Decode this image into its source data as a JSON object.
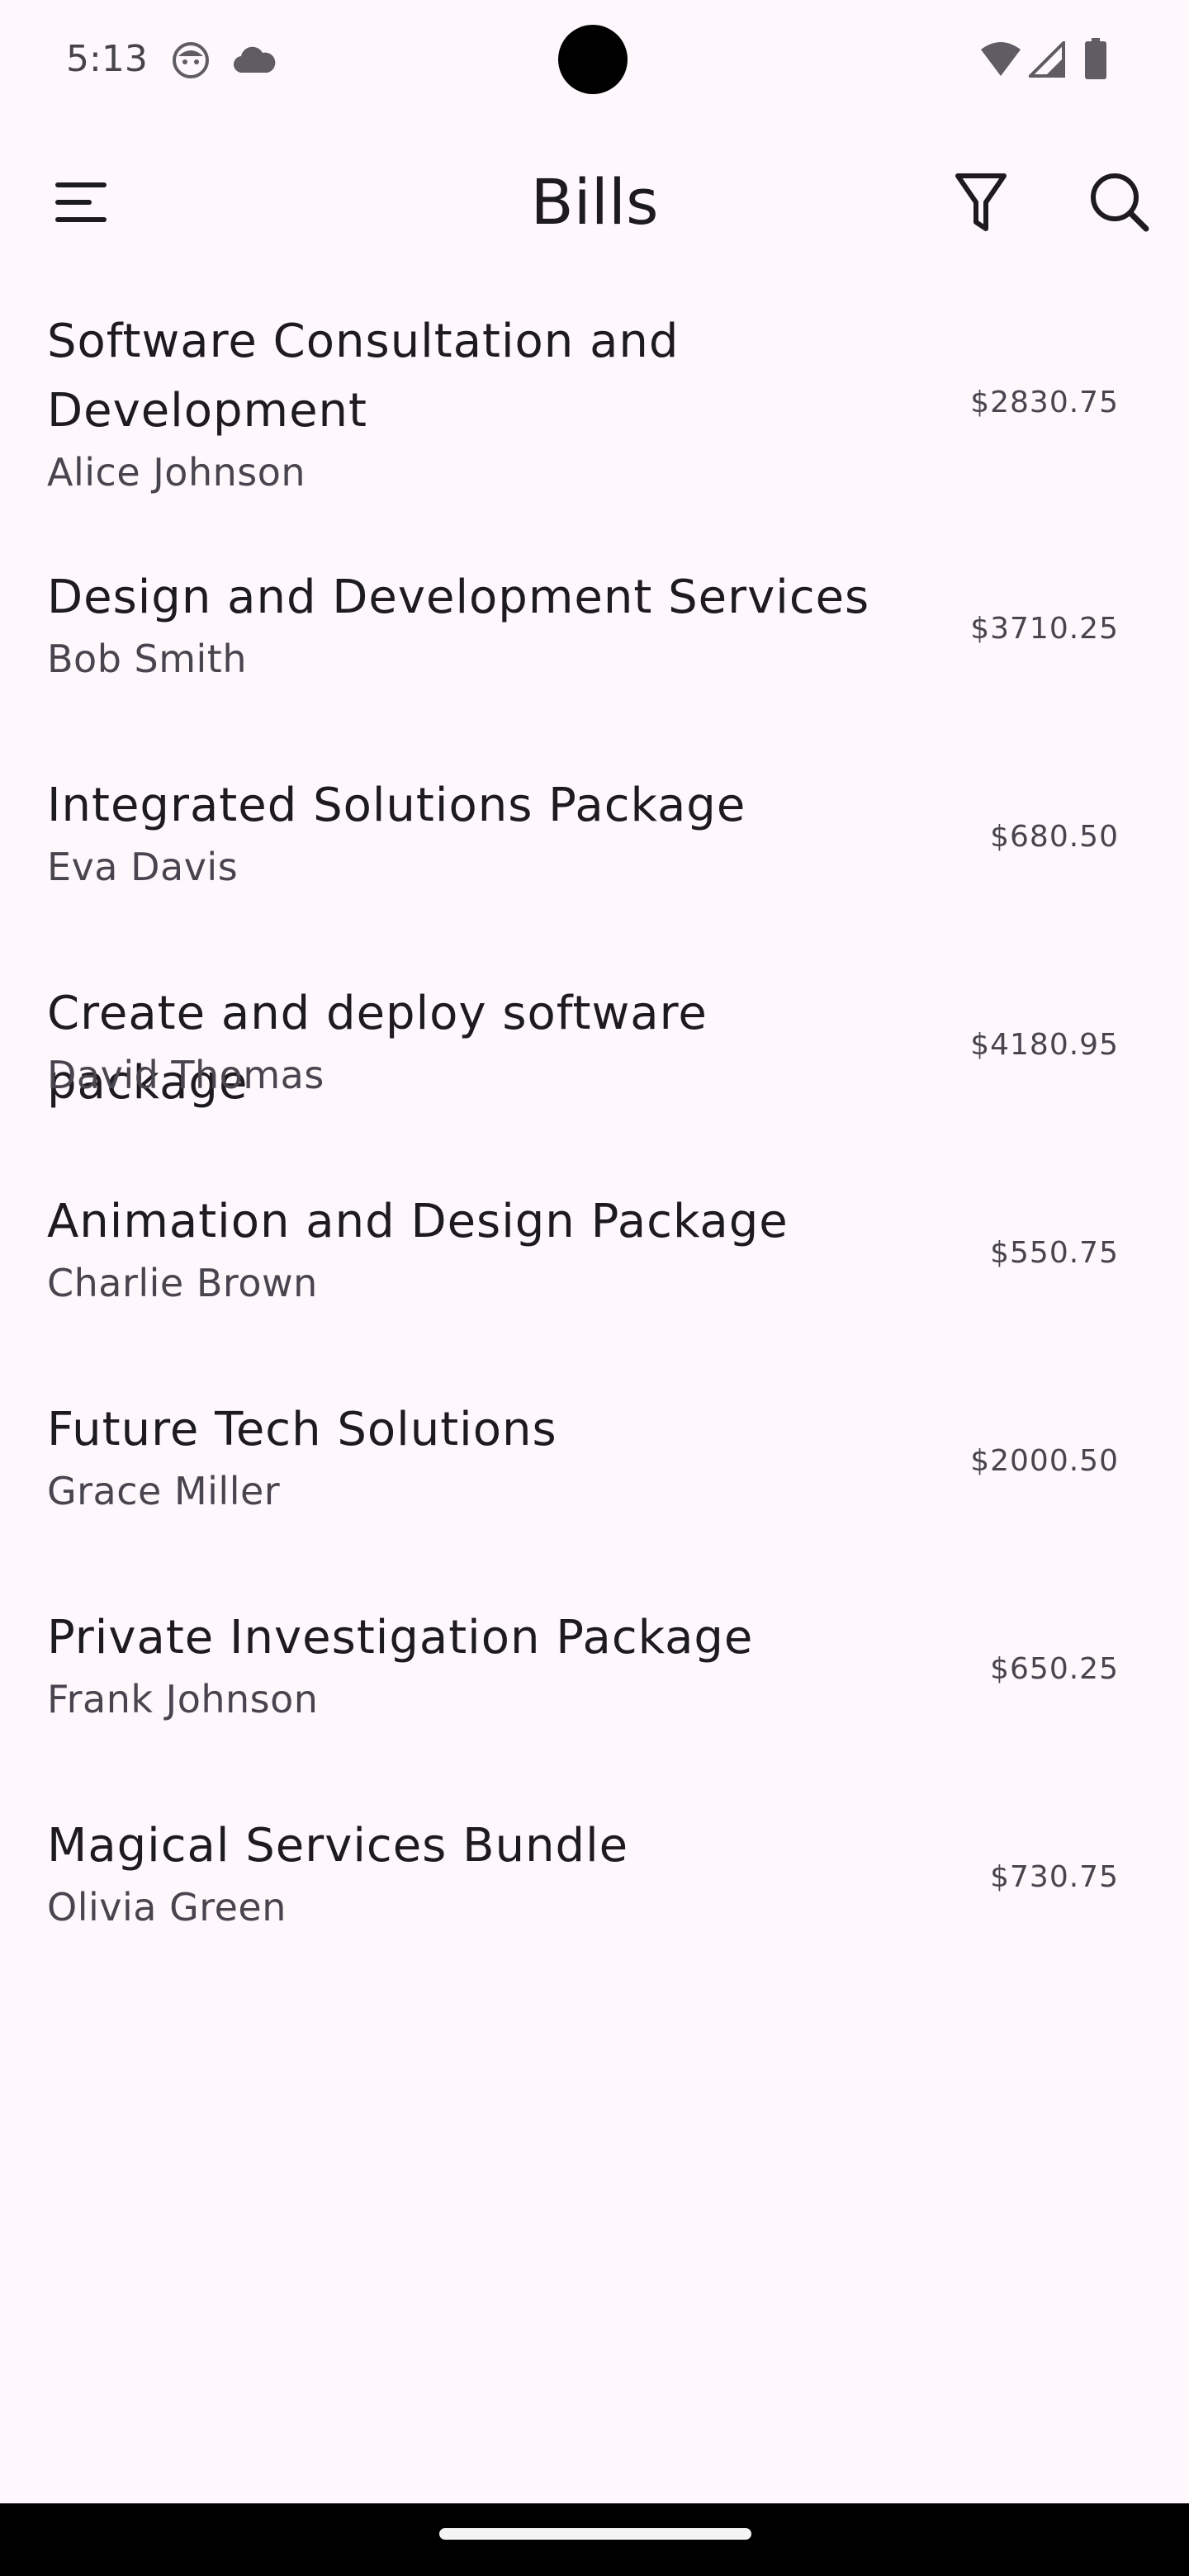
{
  "status_bar": {
    "time": "5:13",
    "icons": [
      "face-icon",
      "cloud-icon",
      "wifi-icon",
      "signal-icon",
      "battery-icon"
    ]
  },
  "app_bar": {
    "title": "Bills",
    "icons": [
      "menu-icon",
      "filter-icon",
      "search-icon"
    ]
  },
  "bills": [
    {
      "title": "Software Consultation and Development",
      "client": "Alice Johnson",
      "amount": "$2830.75"
    },
    {
      "title": "Design and Development Services",
      "client": "Bob Smith",
      "amount": "$3710.25"
    },
    {
      "title": "Integrated Solutions Package",
      "client": "Eva Davis",
      "amount": "$680.50"
    },
    {
      "title": "Create and deploy software package",
      "client": "David Thomas",
      "amount": "$4180.95"
    },
    {
      "title": "Animation and Design Package",
      "client": "Charlie Brown",
      "amount": "$550.75"
    },
    {
      "title": "Future Tech Solutions",
      "client": "Grace Miller",
      "amount": "$2000.50"
    },
    {
      "title": "Private Investigation Package",
      "client": "Frank Johnson",
      "amount": "$650.25"
    },
    {
      "title": "Magical Services Bundle",
      "client": "Olivia Green",
      "amount": "$730.75"
    }
  ],
  "colors": {
    "background": "#fef7fc",
    "text_primary": "#1d1b20",
    "text_secondary": "#49454f"
  }
}
